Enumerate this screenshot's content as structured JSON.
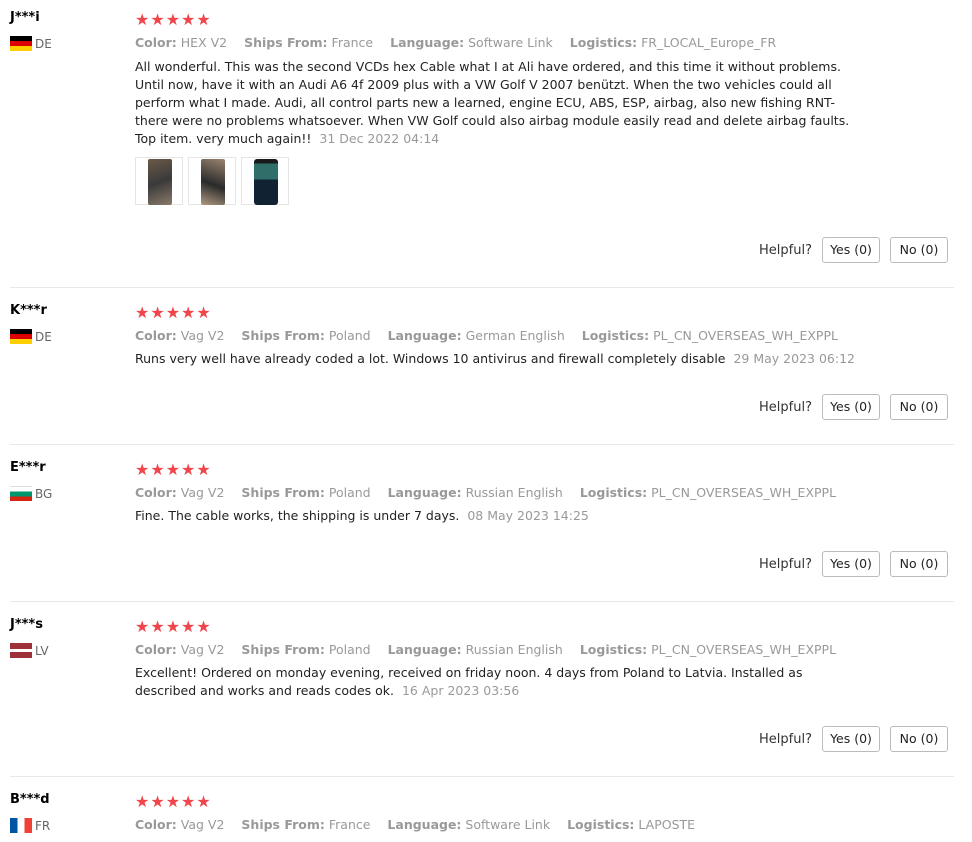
{
  "labels": {
    "color": "Color:",
    "ships_from": "Ships From:",
    "language": "Language:",
    "logistics": "Logistics:",
    "helpful": "Helpful?"
  },
  "stars_text": "★★★★★",
  "reviews": [
    {
      "user": "J***i",
      "country": "DE",
      "rating": 5,
      "color": "HEX V2",
      "ships_from": "France",
      "language": "Software Link",
      "logistics": "FR_LOCAL_Europe_FR",
      "text": "All wonderful. This was the second VCDs hex Cable what I at Ali have ordered, and this time it without problems. Until now, have it with an Audi A6 4f 2009 plus with a VW Golf V 2007 benützt. When the two vehicles could all perform what I made. Audi, all control parts new a learned, engine ECU, ABS, ESP, airbag, also new fishing RNT-there were no problems whatsoever. When VW Golf could also airbag module easily read and delete airbag faults. Top item. very much again!!",
      "date": "31 Dec 2022 04:14",
      "yes": "Yes (0)",
      "no": "No (0)"
    },
    {
      "user": "K***r",
      "country": "DE",
      "rating": 5,
      "color": "Vag V2",
      "ships_from": "Poland",
      "language": "German English",
      "logistics": "PL_CN_OVERSEAS_WH_EXPPL",
      "text": "Runs very well have already coded a lot. Windows 10 antivirus and firewall completely disable",
      "date": "29 May 2023 06:12",
      "yes": "Yes (0)",
      "no": "No (0)"
    },
    {
      "user": "E***r",
      "country": "BG",
      "rating": 5,
      "color": "Vag V2",
      "ships_from": "Poland",
      "language": "Russian English",
      "logistics": "PL_CN_OVERSEAS_WH_EXPPL",
      "text": "Fine. The cable works, the shipping is under 7 days.",
      "date": "08 May 2023 14:25",
      "yes": "Yes (0)",
      "no": "No (0)"
    },
    {
      "user": "J***s",
      "country": "LV",
      "rating": 5,
      "color": "Vag V2",
      "ships_from": "Poland",
      "language": "Russian English",
      "logistics": "PL_CN_OVERSEAS_WH_EXPPL",
      "text": "Excellent! Ordered on monday evening, received on friday noon. 4 days from Poland to Latvia. Installed as described and works and reads codes ok.",
      "date": "16 Apr 2023 03:56",
      "yes": "Yes (0)",
      "no": "No (0)"
    },
    {
      "user": "B***d",
      "country": "FR",
      "rating": 5,
      "color": "Vag V2",
      "ships_from": "France",
      "language": "Software Link",
      "logistics": "LAPOSTE"
    }
  ]
}
